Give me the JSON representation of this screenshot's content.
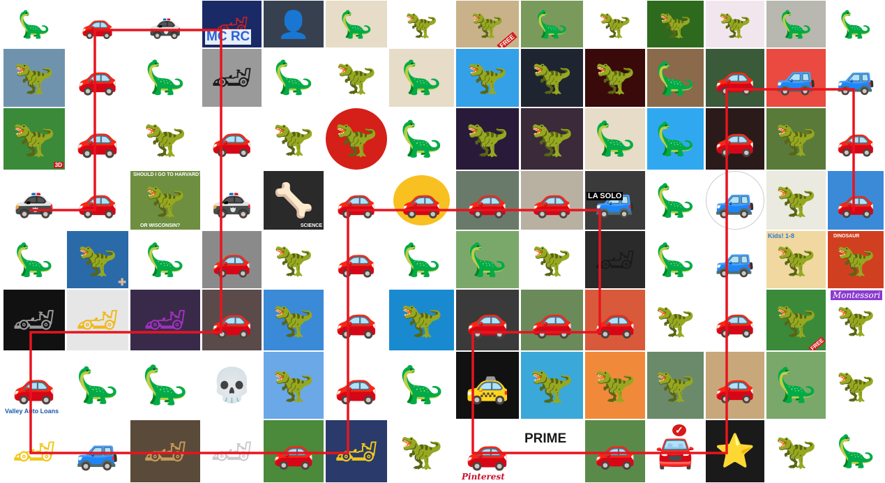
{
  "tiles": [
    {
      "name": "dinosaur-image",
      "icon": "🦕",
      "fg": "#8a7a70",
      "bg": "#ffffff"
    },
    {
      "name": "car-image",
      "icon": "🚗",
      "fg": "#222222",
      "bg": "#ffffff"
    },
    {
      "name": "car-image",
      "icon": "🚓",
      "fg": "#2255cc",
      "bg": "#ffffff"
    },
    {
      "name": "car-image",
      "icon": "🏎",
      "fg": "#cc2222",
      "bg": "#1a2a66",
      "captions": [
        {
          "text": "MC RC",
          "style": "color:#2a62d8;font-size:19px;bottom:4px;left:4px;background:#e8eef8;padding:0 2px;"
        }
      ]
    },
    {
      "name": "person-image",
      "icon": "👤",
      "fg": "#e8e0d8",
      "bg": "#37404e"
    },
    {
      "name": "dinosaur-image",
      "icon": "🦕",
      "fg": "#7a5020",
      "bg": "#e6dcc7"
    },
    {
      "name": "dinosaur-image",
      "icon": "🦖",
      "fg": "#4a6aa0",
      "bg": "#ffffff"
    },
    {
      "name": "dinosaur-image",
      "icon": "🦖",
      "fg": "#7a4a2a",
      "bg": "#c9b28a",
      "captions": [
        {
          "text": "FREE",
          "style": "color:#ffffff;font-size:9px;bottom:4px;right:2px;background:#d0201e;padding:0 3px;transform:rotate(-40deg);"
        }
      ]
    },
    {
      "name": "dinosaur-image",
      "icon": "🦕",
      "fg": "#3c5a2a",
      "bg": "#7a9a5c"
    },
    {
      "name": "dinosaur-image",
      "icon": "🦖",
      "fg": "#f0d020",
      "bg": "#ffffff"
    },
    {
      "name": "dinosaur-image",
      "icon": "🦖",
      "fg": "#a05a20",
      "bg": "#2e6a1e"
    },
    {
      "name": "dinosaur-image",
      "icon": "🦖",
      "fg": "#111111",
      "bg": "#f2e6ee"
    },
    {
      "name": "dinosaur-image",
      "icon": "🦕",
      "fg": "#6a6050",
      "bg": "#b8b8b0"
    },
    {
      "name": "dinosaur-image",
      "icon": "🦕",
      "fg": "#6a6a62",
      "bg": "#ffffff"
    },
    {
      "name": "dinosaur-image",
      "icon": "🦖",
      "fg": "#5a6a5a",
      "bg": "#6f93ad"
    },
    {
      "name": "car-image",
      "icon": "🚗",
      "fg": "#1e8fb4",
      "bg": "#ffffff"
    },
    {
      "name": "dinosaur-image",
      "icon": "🦕",
      "fg": "#c8681e",
      "bg": "#ffffff"
    },
    {
      "name": "car-image",
      "icon": "🏎",
      "fg": "#1a1a1a",
      "bg": "#9a9a9a"
    },
    {
      "name": "dinosaur-image",
      "icon": "🦕",
      "fg": "#4a4438",
      "bg": "#ffffff"
    },
    {
      "name": "dinosaur-image",
      "icon": "🦖",
      "fg": "#5a3028",
      "bg": "#ffffff"
    },
    {
      "name": "dinosaur-image",
      "icon": "🦕",
      "fg": "#3a3a36",
      "bg": "#e6dcc7"
    },
    {
      "name": "dinosaur-image",
      "icon": "🦖",
      "fg": "#ff8a10",
      "bg": "#34a0e8"
    },
    {
      "name": "dinosaur-image",
      "icon": "🦖",
      "fg": "#9a9a9a",
      "bg": "#1e2430"
    },
    {
      "name": "dinosaur-image",
      "icon": "🦖",
      "fg": "#3050c8",
      "bg": "#3a0a0a"
    },
    {
      "name": "dinosaur-image",
      "icon": "🦕",
      "fg": "#70b4c0",
      "bg": "#8a6a4a"
    },
    {
      "name": "car-image",
      "icon": "🚗",
      "fg": "#cc2a2a",
      "bg": "#3a5a3a"
    },
    {
      "name": "car-image",
      "icon": "🚙",
      "fg": "#2a6ec8",
      "bg": "#ea4a40"
    },
    {
      "name": "car-image",
      "icon": "🚙",
      "fg": "#3aaa4a",
      "bg": "#ffffff"
    },
    {
      "name": "dinosaur-image",
      "icon": "🦖",
      "fg": "#c02a20",
      "bg": "#3a8a3a",
      "captions": [
        {
          "text": "3D",
          "style": "color:#ffffff;font-size:8px;bottom:2px;right:2px;background:#c02020;padding:0 2px;"
        }
      ]
    },
    {
      "name": "car-image",
      "icon": "🚗",
      "fg": "#8a8e94",
      "bg": "#ffffff"
    },
    {
      "name": "dinosaur-image",
      "icon": "🦖",
      "fg": "#000000",
      "bg": "#ffffff"
    },
    {
      "name": "car-image",
      "icon": "🚗",
      "fg": "#d01a1a",
      "bg": "#ffffff"
    },
    {
      "name": "dinosaur-image",
      "icon": "🦖",
      "fg": "#6a8aa0",
      "bg": "#ffffff"
    },
    {
      "name": "dinosaur-image",
      "icon": "🦖",
      "fg": "#000000",
      "bg": "#d42018",
      "round": "50%"
    },
    {
      "name": "dinosaur-image",
      "icon": "🦕",
      "fg": "#000000",
      "bg": "#ffffff"
    },
    {
      "name": "dinosaur-image",
      "icon": "🦖",
      "fg": "#3aa83a",
      "bg": "#2a1a3a"
    },
    {
      "name": "dinosaur-image",
      "icon": "🦖",
      "fg": "#f0a8c0",
      "bg": "#3a2a3a"
    },
    {
      "name": "dinosaur-image",
      "icon": "🦕",
      "fg": "#6a5a3a",
      "bg": "#e6dcc7"
    },
    {
      "name": "dinosaur-image",
      "icon": "🦕",
      "fg": "#4060c8",
      "bg": "#30a8f0"
    },
    {
      "name": "car-image",
      "icon": "🚗",
      "fg": "#c01a1a",
      "bg": "#2a1a1a"
    },
    {
      "name": "dinosaur-image",
      "icon": "🦖",
      "fg": "#a05a20",
      "bg": "#5a7a3a"
    },
    {
      "name": "car-image",
      "icon": "🚗",
      "fg": "#9a9a9a",
      "bg": "#ffffff"
    },
    {
      "name": "car-image",
      "icon": "🚓",
      "fg": "#111111",
      "bg": "#ffffff"
    },
    {
      "name": "car-image",
      "icon": "🚗",
      "fg": "#c81a1a",
      "bg": "#ffffff"
    },
    {
      "name": "dinosaur-image",
      "icon": "🦖",
      "fg": "#3a5a2a",
      "bg": "#6e8e40",
      "captions": [
        {
          "text": "SHOULD I GO TO HARVARD?",
          "style": "color:#ffffff;font-size:7px;top:2px;left:4px;"
        },
        {
          "text": "OR WISCONSIN?",
          "style": "color:#ffffff;font-size:7px;bottom:2px;left:14px;"
        }
      ]
    },
    {
      "name": "car-image",
      "icon": "🚓",
      "fg": "#111111",
      "bg": "#ffffff"
    },
    {
      "name": "dinosaur-image",
      "icon": "🦴",
      "fg": "#d8d0c0",
      "bg": "#2a2a2a",
      "captions": [
        {
          "text": "SCIENCE",
          "style": "color:#ffffff;font-size:7px;bottom:2px;right:2px;"
        }
      ]
    },
    {
      "name": "car-image",
      "icon": "🚗",
      "fg": "#e01a2a",
      "bg": "#ffffff"
    },
    {
      "name": "car-image",
      "icon": "🚗",
      "fg": "#f04a20",
      "bg": "#ffffff",
      "circle": "#f8c020"
    },
    {
      "name": "car-image",
      "icon": "🚗",
      "fg": "#ffffff",
      "bg": "#6a7a6a"
    },
    {
      "name": "car-image",
      "icon": "🚗",
      "fg": "#8a8a8a",
      "bg": "#b8b0a0"
    },
    {
      "name": "car-image",
      "icon": "🚙",
      "fg": "#eaeaea",
      "bg": "#3a3a3a",
      "captions": [
        {
          "text": "LA SOLO",
          "style": "color:#ffffff;font-size:11px;top:30px;left:2px;background:#000000;padding:0 2px;"
        }
      ]
    },
    {
      "name": "dinosaur-image",
      "icon": "🦕",
      "fg": "#000000",
      "bg": "#ffffff"
    },
    {
      "name": "car-image",
      "icon": "🚙",
      "fg": "#222222",
      "bg": "#ffffff",
      "round": "50%",
      "border": "1px solid #cccccc"
    },
    {
      "name": "dinosaur-image",
      "icon": "🦖",
      "fg": "#5a7a4a",
      "bg": "#eaeae0"
    },
    {
      "name": "car-image",
      "icon": "🚗",
      "fg": "#c01a1a",
      "bg": "#3a8ad8"
    },
    {
      "name": "dinosaur-image",
      "icon": "🦕",
      "fg": "#c89a6a",
      "bg": "#ffffff"
    },
    {
      "name": "dinosaur-image",
      "icon": "🦖",
      "fg": "#c87a2a",
      "bg": "#2a6aa8",
      "captions": [
        {
          "text": "✚",
          "style": "color:#d8b8a0;font-size:14px;bottom:0px;right:3px;"
        }
      ]
    },
    {
      "name": "dinosaur-image",
      "icon": "🦕",
      "fg": "#000000",
      "bg": "#ffffff"
    },
    {
      "name": "car-image",
      "icon": "🚗",
      "fg": "#1a1a1a",
      "bg": "#8a8a8a"
    },
    {
      "name": "dinosaur-image",
      "icon": "🦖",
      "fg": "#2aa82a",
      "bg": "#ffffff"
    },
    {
      "name": "car-image",
      "icon": "🚗",
      "fg": "#3a6ac8",
      "bg": "#ffffff"
    },
    {
      "name": "dinosaur-image",
      "icon": "🦕",
      "fg": "#8ab82a",
      "bg": "#ffffff"
    },
    {
      "name": "dinosaur-image",
      "icon": "🦕",
      "fg": "#4a4a3a",
      "bg": "#7aa86a"
    },
    {
      "name": "dinosaur-image",
      "icon": "🦖",
      "fg": "#aad08a",
      "bg": "#ffffff"
    },
    {
      "name": "car-image",
      "icon": "🏎",
      "fg": "#1a1a1a",
      "bg": "#2a2a2a"
    },
    {
      "name": "dinosaur-image",
      "icon": "🦕",
      "fg": "#e0b87a",
      "bg": "#ffffff"
    },
    {
      "name": "car-image",
      "icon": "🚙",
      "fg": "#1a3a9a",
      "bg": "#ffffff"
    },
    {
      "name": "dinosaur-image",
      "icon": "🦖",
      "fg": "#9a6a3a",
      "bg": "#f0d8a0",
      "captions": [
        {
          "text": "Kids! 1-8",
          "style": "color:#2a7ad8;font-size:9px;top:2px;left:2px;"
        }
      ]
    },
    {
      "name": "dinosaur-image",
      "icon": "🦖",
      "fg": "#d8a020",
      "bg": "#d04020",
      "captions": [
        {
          "text": "DINOSAUR",
          "style": "color:#ffffff;font-size:7px;top:4px;left:8px;"
        }
      ]
    },
    {
      "name": "car-image",
      "icon": "🏎",
      "fg": "#9a9a9a",
      "bg": "#111111"
    },
    {
      "name": "car-image",
      "icon": "🏎",
      "fg": "#f0b81a",
      "bg": "#e6e6e6"
    },
    {
      "name": "car-image",
      "icon": "🏎",
      "fg": "#a030c0",
      "bg": "#3a2a4a"
    },
    {
      "name": "car-image",
      "icon": "🚗",
      "fg": "#b03a2a",
      "bg": "#5a4a4a"
    },
    {
      "name": "dinosaur-image",
      "icon": "🦖",
      "fg": "#8a4ac8",
      "bg": "#3a8ad8"
    },
    {
      "name": "car-image",
      "icon": "🚗",
      "fg": "#111111",
      "bg": "#ffffff"
    },
    {
      "name": "dinosaur-image",
      "icon": "🦖",
      "fg": "#d02020",
      "bg": "#1a8ad0"
    },
    {
      "name": "car-image",
      "icon": "🚗",
      "fg": "#eaeaea",
      "bg": "#3a3a3a"
    },
    {
      "name": "car-image",
      "icon": "🚗",
      "fg": "#dadada",
      "bg": "#6a8a5a"
    },
    {
      "name": "car-image",
      "icon": "🚗",
      "fg": "#eaeaea",
      "bg": "#d85a3a"
    },
    {
      "name": "dinosaur-image",
      "icon": "🦖",
      "fg": "#2a3a7a",
      "bg": "#ffffff"
    },
    {
      "name": "car-image",
      "icon": "🚗",
      "fg": "#eacc3a",
      "bg": "#ffffff"
    },
    {
      "name": "dinosaur-image",
      "icon": "🦖",
      "fg": "#d85a2a",
      "bg": "#3a8a3a",
      "captions": [
        {
          "text": "FREE",
          "style": "color:#ffffff;font-size:8px;bottom:4px;right:0px;background:#d0201e;padding:0 2px;transform:rotate(-40deg);"
        }
      ]
    },
    {
      "name": "dinosaur-image",
      "icon": "🦖",
      "fg": "#c86a2a",
      "bg": "#ffffff",
      "captions": [
        {
          "text": "Montessori",
          "style": "color:#ffffff;font-size:12px;top:1px;left:4px;background:#8a3ad0;padding:0 3px;font-style:italic;font-weight:normal;font-family:'DejaVu Serif',serif;"
        }
      ]
    },
    {
      "name": "advertisement-image",
      "icon": "🚗",
      "fg": "#8a8a8a",
      "bg": "#ffffff",
      "captions": [
        {
          "text": "Valley Auto Loans",
          "style": "color:#1a5aa8;font-size:9px;bottom:6px;left:2px;"
        }
      ]
    },
    {
      "name": "dinosaur-image",
      "icon": "🦕",
      "fg": "#7a5a4a",
      "bg": "#ffffff"
    },
    {
      "name": "dinosaur-image",
      "icon": "🦕",
      "fg": "#6a7a3a",
      "bg": "#ffffff"
    },
    {
      "name": "dinosaur-image",
      "icon": "💀",
      "fg": "#eaeaea",
      "bg": "#ffffff"
    },
    {
      "name": "dinosaur-image",
      "icon": "🦖",
      "fg": "#7a5a3a",
      "bg": "#6aa8e8"
    },
    {
      "name": "car-image",
      "icon": "🚗",
      "fg": "#2a2a2a",
      "bg": "#ffffff"
    },
    {
      "name": "dinosaur-image",
      "icon": "🦕",
      "fg": "#1a1a6a",
      "bg": "#ffffff"
    },
    {
      "name": "car-image",
      "icon": "🚕",
      "fg": "#f0c81a",
      "bg": "#111111"
    },
    {
      "name": "dinosaur-image",
      "icon": "🦖",
      "fg": "#8a4a2a",
      "bg": "#3aa8d8"
    },
    {
      "name": "dinosaur-image",
      "icon": "🦖",
      "fg": "#3a3a3a",
      "bg": "#f08a3a"
    },
    {
      "name": "dinosaur-image",
      "icon": "🦖",
      "fg": "#2a5a2a",
      "bg": "#6a8a6a"
    },
    {
      "name": "car-image",
      "icon": "🚗",
      "fg": "#eaeaea",
      "bg": "#c8a87a"
    },
    {
      "name": "dinosaur-image",
      "icon": "🦕",
      "fg": "#8a8a8a",
      "bg": "#7aa86a"
    },
    {
      "name": "dinosaur-image",
      "icon": "🦖",
      "fg": "#c8a03a",
      "bg": "#ffffff"
    },
    {
      "name": "car-image",
      "icon": "🏎",
      "fg": "#f0c81a",
      "bg": "#ffffff"
    },
    {
      "name": "car-image",
      "icon": "🚙",
      "fg": "#7aaad8",
      "bg": "#ffffff"
    },
    {
      "name": "car-image",
      "icon": "🏎",
      "fg": "#c89a5a",
      "bg": "#5a4a3a"
    },
    {
      "name": "car-image",
      "icon": "🏎",
      "fg": "#cacaca",
      "bg": "#ffffff"
    },
    {
      "name": "car-image",
      "icon": "🚗",
      "fg": "#ffffff",
      "bg": "#4a8a3a"
    },
    {
      "name": "car-image",
      "icon": "🏎",
      "fg": "#f0c81a",
      "bg": "#2a3a6a"
    },
    {
      "name": "dinosaur-image",
      "icon": "🦖",
      "fg": "#8a7a4a",
      "bg": "#ffffff"
    },
    {
      "name": "car-image",
      "icon": "🚗",
      "fg": "#d01a1a",
      "bg": "#ffffff",
      "captions": [
        {
          "text": "Pinterest",
          "style": "color:#c8102e;font-size:12px;bottom:1px;left:8px;font-style:italic;font-family:'DejaVu Serif',serif;"
        }
      ]
    },
    {
      "name": "advertisement-image",
      "icon": "",
      "fg": "#d01a1a",
      "bg": "#ffffff",
      "captions": [
        {
          "text": "PRIME",
          "style": "color:#1a1a1a;font-size:19px;top:16px;left:5px;"
        }
      ]
    },
    {
      "name": "car-image",
      "icon": "🚗",
      "fg": "#1a1a1a",
      "bg": "#5a8a4a"
    },
    {
      "name": "car-image",
      "icon": "🚘",
      "fg": "#1a5aa8",
      "bg": "#ffffff",
      "captions": [
        {
          "text": "✓",
          "style": "color:#ffffff;font-size:14px;top:6px;left:36px;background:#d81a1a;border-radius:50%;padding:0 4px;"
        }
      ]
    },
    {
      "name": "car-image",
      "icon": "⭐",
      "fg": "#d8c8a0",
      "bg": "#1a1a1a"
    },
    {
      "name": "dinosaur-image",
      "icon": "🦖",
      "fg": "#000000",
      "bg": "#ffffff"
    },
    {
      "name": "dinosaur-image",
      "icon": "🦕",
      "fg": "#6a8a3a",
      "bg": "#ffffff"
    }
  ]
}
